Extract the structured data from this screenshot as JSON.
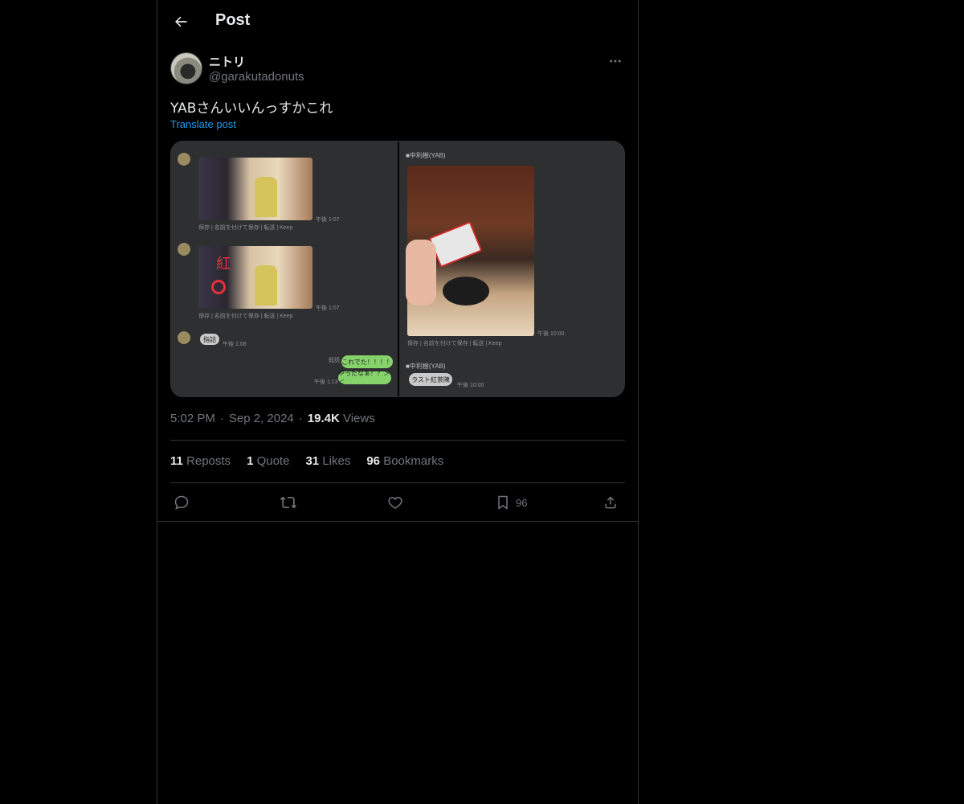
{
  "header": {
    "title": "Post"
  },
  "author": {
    "display_name": "ニトリ",
    "handle": "@garakutadonuts"
  },
  "post": {
    "text": "YABさんいいんっすかこれ",
    "translate_label": "Translate post",
    "image_alt_text": {
      "left_bubble_1": "これでた！！！！",
      "left_bubble_2": "やったなぁ！？＞＜",
      "right_sender": "■中利樹(YAB)",
      "right_sender_2": "■中利樹(YAB)",
      "right_bubble": "ラスト紅茶陳",
      "red_kanji": "紅",
      "left_small_bubble": "指詰"
    }
  },
  "meta": {
    "time": "5:02 PM",
    "date": "Sep 2, 2024",
    "views_count": "19.4K",
    "views_label": "Views"
  },
  "stats": {
    "reposts_count": "11",
    "reposts_label": "Reposts",
    "quote_count": "1",
    "quote_label": "Quote",
    "likes_count": "31",
    "likes_label": "Likes",
    "bookmarks_count": "96",
    "bookmarks_label": "Bookmarks"
  },
  "actions": {
    "bookmark_count": "96"
  },
  "colors": {
    "background": "#000000",
    "accent": "#1d9bf0",
    "secondary_text": "#71767b",
    "border": "#2f3336"
  },
  "icons": [
    "back-arrow-icon",
    "more-icon",
    "reply-icon",
    "repost-icon",
    "like-icon",
    "bookmark-icon",
    "share-icon"
  ]
}
